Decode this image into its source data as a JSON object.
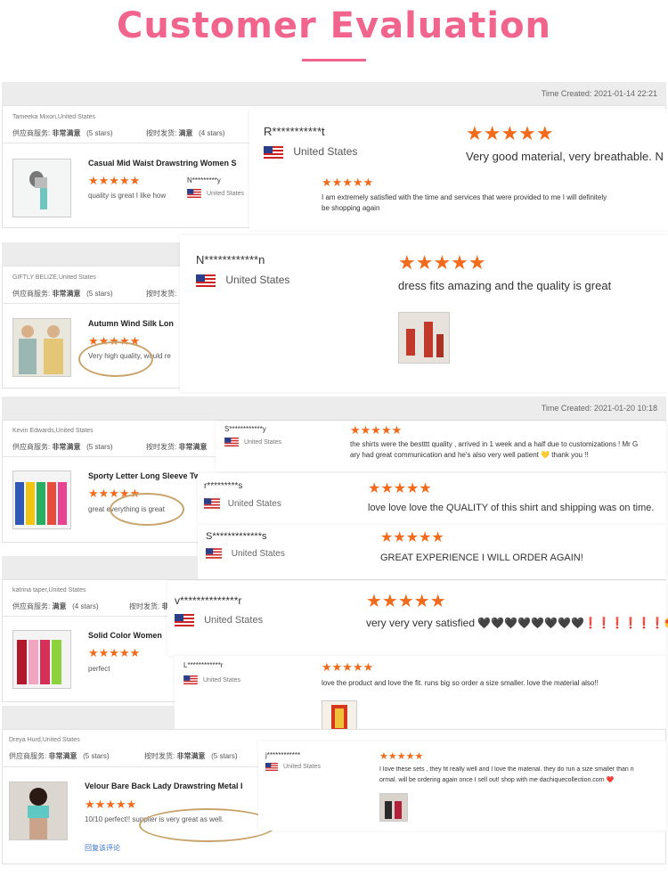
{
  "header": {
    "title": "Customer Evaluation"
  },
  "colors": {
    "accent": "#f0648d",
    "star": "#f26a1b",
    "oval": "#c8a46c"
  },
  "time_created_1": "Time Created: 2021-01-14 22:21",
  "time_created_2": "Time Created: 2021-01-20 10:18",
  "row_labels": {
    "supplier": "供应商服务:",
    "delivery": "按时发货:",
    "very_satisfied": "非常满意",
    "satisfied": "满意",
    "five": "(5 stars)",
    "four": "(4 stars)"
  },
  "cards": [
    {
      "user": "Tameeka Mixon,United States",
      "supplier": "非常满意",
      "supplier_stars": "(5 stars)",
      "delivery": "满意",
      "delivery_stars": "(4 stars)",
      "product": "Casual Mid Waist Drawstring Women S",
      "comment": "quality is great I like how"
    },
    {
      "user": "GIFTLY BELIZE,United States",
      "supplier": "非常满意",
      "supplier_stars": "(5 stars)",
      "product": "Autumn Wind Silk Lon",
      "comment": "Very high quality, would re"
    },
    {
      "user": "Kevin Edwards,United States",
      "supplier": "非常满意",
      "supplier_stars": "(5 stars)",
      "delivery": "非常满意",
      "product": "Sporty Letter Long Sleeve Two",
      "comment": "great everything is great"
    },
    {
      "user": "katrina taper,United States",
      "supplier": "满意",
      "supplier_stars": "(4 stars)",
      "delivery": "非常满意",
      "product": "Solid Color Women",
      "comment": "perfect"
    },
    {
      "user": "Dreya Hurd,United States",
      "supplier": "非常满意",
      "supplier_stars": "(5 stars)",
      "delivery": "非常满意",
      "delivery_stars": "(5 stars)",
      "product": "Velour Bare Back Lady Drawstring Metal I",
      "comment": "10/10 perfect!! supplier is very great as well.",
      "reply": "回复该评论"
    }
  ],
  "reviews": [
    {
      "name": "R***********t",
      "country": "United States",
      "text": "Very good material, very breathable. N"
    },
    {
      "name": "N*********y",
      "country": "United States",
      "text": "I am extremely satisfied with the time and services that were provided to me I will definitely",
      "text2": "be shopping again"
    },
    {
      "name": "N************n",
      "country": "United States",
      "text": "dress fits amazing and the quality is great"
    },
    {
      "name": "S************y",
      "country": "United States",
      "text": "the shirts were the bestttt quality , arrived in 1 week and a half due to customizations ! Mr G",
      "text2": "ary had great communication and he's also very well patient 💛 thank you !!"
    },
    {
      "name": "r*********s",
      "country": "United States",
      "text": "love love love the QUALITY of this shirt and shipping was on time."
    },
    {
      "name": "S*************s",
      "country": "United States",
      "text": "GREAT EXPERIENCE I WILL ORDER AGAIN!"
    },
    {
      "name": "v**************r",
      "country": "United States",
      "text": "very very very satisfied 🖤🖤🖤🖤🖤🖤🖤🖤❗❗❗❗❗❗😍😋"
    },
    {
      "name": "L************r",
      "country": "United States",
      "text": "love the product and love the fit. runs big so order a size smaller. love the material also!!"
    },
    {
      "name": "j************",
      "country": "United States",
      "text": "I love these sets , they fit really well and I love the material. they do run a size smaller than n",
      "text2": "ormal. will be ordering again once I sell out! shop with me dachiquecollection.com ❤️"
    }
  ],
  "stars": "★★★★★",
  "review_stars": "★★★★★",
  "review_card_stars": "★★★★★",
  "review_card_stars_4": "★★★★"
}
